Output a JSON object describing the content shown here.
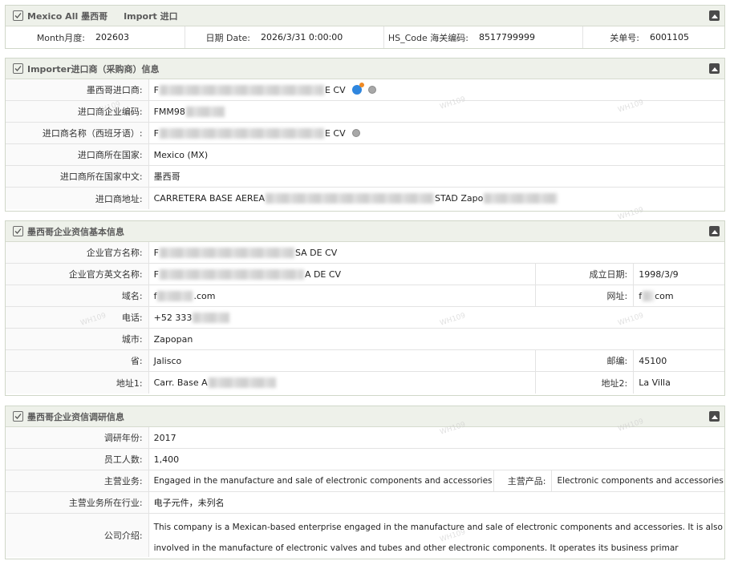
{
  "panel1": {
    "title": "Mexico All 墨西哥",
    "subtitle": "Import 进口",
    "fields": [
      {
        "label": "Month月度:",
        "value": "202603"
      },
      {
        "label": "日期 Date:",
        "value": "2026/3/31 0:00:00"
      },
      {
        "label": "HS_Code 海关编码:",
        "value": "8517799999"
      },
      {
        "label": "关单号:",
        "value": "6001105"
      }
    ]
  },
  "panel2": {
    "title": "Importer进口商（采购商）信息",
    "rows": [
      {
        "label": "墨西哥进口商:",
        "prefix": "F",
        "suffix": "E CV"
      },
      {
        "label": "进口商企业编码:",
        "prefix": "FMM98",
        "suffix": ""
      },
      {
        "label": "进口商名称（西班牙语）:",
        "prefix": "F",
        "suffix": "E CV"
      },
      {
        "label": "进口商所在国家:",
        "value": "Mexico (MX)"
      },
      {
        "label": "进口商所在国家中文:",
        "value": "墨西哥"
      },
      {
        "label": "进口商地址:",
        "prefix": "CARRETERA BASE AEREA",
        "middle": "STAD Zapo",
        "suffix": ""
      }
    ]
  },
  "panel3": {
    "title": "墨西哥企业资信基本信息",
    "rows": [
      {
        "label": "企业官方名称:",
        "prefix": "F",
        "suffix": "SA DE CV"
      },
      {
        "label": "企业官方英文名称:",
        "prefix": "F",
        "suffix": "A DE CV",
        "label2": "成立日期:",
        "value2": "1998/3/9"
      },
      {
        "label": "域名:",
        "prefix": "f",
        "suffix": ".com",
        "label2": "网址:",
        "prefix2": "f",
        "suffix2": "com"
      },
      {
        "label": "电话:",
        "prefix": "+52 333",
        "suffix": ""
      },
      {
        "label": "城市:",
        "value": "Zapopan"
      },
      {
        "label": "省:",
        "value": "Jalisco",
        "label2": "邮编:",
        "value2": "45100"
      },
      {
        "label": "地址1:",
        "prefix": "Carr. Base A",
        "suffix": "",
        "label2": "地址2:",
        "value2": "La Villa"
      }
    ]
  },
  "panel4": {
    "title": "墨西哥企业资信调研信息",
    "rows": [
      {
        "label": "调研年份:",
        "value": "2017"
      },
      {
        "label": "员工人数:",
        "value": "1,400"
      },
      {
        "label": "主营业务:",
        "value": "Engaged in the manufacture and sale of electronic components and accessories",
        "label2": "主营产品:",
        "value2": "Electronic components and accessories"
      },
      {
        "label": "主营业务所在行业:",
        "value": "电子元件，未列名"
      },
      {
        "label": "公司介绍:",
        "value": "This company is a Mexican-based enterprise engaged in the manufacture and sale of electronic components and accessories. It is also involved in the manufacture of electronic valves and tubes and other electronic components. It operates its business primar"
      }
    ]
  },
  "watermark_text": "WH109"
}
